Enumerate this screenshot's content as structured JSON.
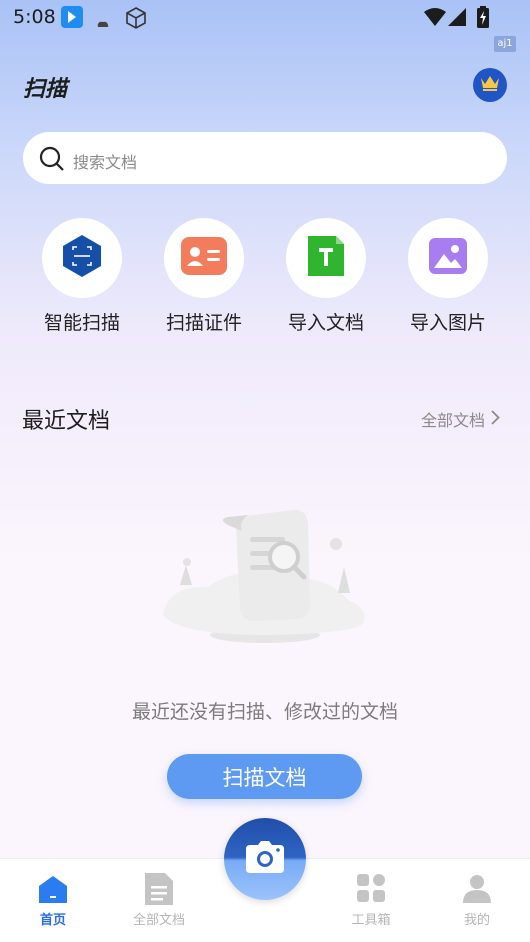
{
  "status_bar": {
    "time": "5:08",
    "indicator": "aj1"
  },
  "header": {
    "title": "扫描",
    "vip_icon": "crown-icon"
  },
  "search": {
    "placeholder": "搜索文档"
  },
  "quick_actions": [
    {
      "label": "智能扫描",
      "icon": "smart-scan-icon",
      "color": "#164fa8"
    },
    {
      "label": "扫描证件",
      "icon": "id-card-icon",
      "color": "#f27c5c"
    },
    {
      "label": "导入文档",
      "icon": "text-document-icon",
      "color": "#2fb52e"
    },
    {
      "label": "导入图片",
      "icon": "image-icon",
      "color": "#a77df0"
    }
  ],
  "recent": {
    "title": "最近文档",
    "all_link": "全部文档",
    "empty_text": "最近还没有扫描、修改过的文档",
    "scan_button": "扫描文档"
  },
  "bottom_nav": [
    {
      "label": "首页",
      "icon": "home-icon",
      "active": true
    },
    {
      "label": "全部文档",
      "icon": "document-icon",
      "active": false
    },
    {
      "label": "工具箱",
      "icon": "toolbox-icon",
      "active": false
    },
    {
      "label": "我的",
      "icon": "profile-icon",
      "active": false
    }
  ],
  "colors": {
    "accent": "#2b6de0",
    "button": "#5e9af2"
  }
}
